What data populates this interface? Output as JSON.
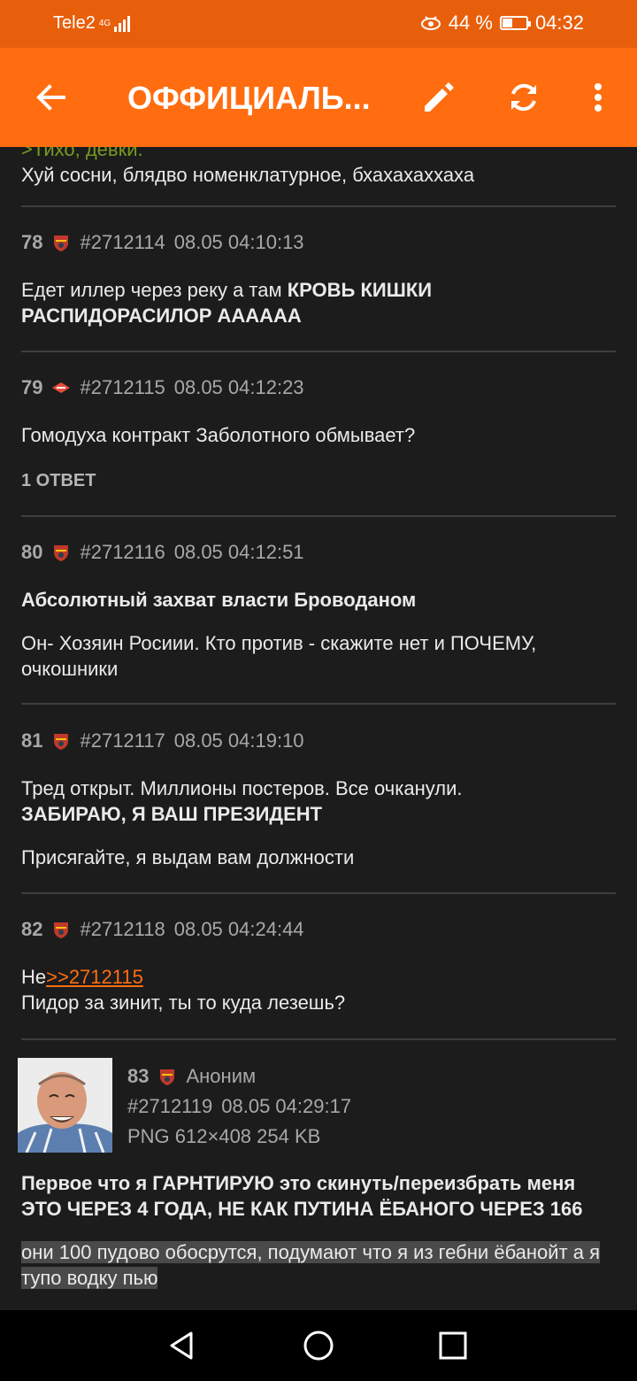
{
  "status": {
    "carrier": "Tele2",
    "network": "4G",
    "battery_pct_text": "44 %",
    "battery_level": 0.44,
    "time": "04:32"
  },
  "toolbar": {
    "title": "ОФФИЦИАЛЬ...",
    "icons": [
      "back-arrow-icon",
      "pencil-icon",
      "refresh-icon",
      "more-vert-icon"
    ]
  },
  "partial": {
    "greentext": ">Тихо, девки.",
    "text": "Хуй сосни, блядво номенклатурное, бхахахаххаха"
  },
  "posts": [
    {
      "num": "78",
      "id": "#2712114",
      "date": "08.05 04:10:13",
      "text_plain": "Едет иллер через реку а там ",
      "text_bold": "КРОВЬ КИШКИ РАСПИДОРАСИЛОР АААААА"
    },
    {
      "num": "79",
      "id": "#2712115",
      "date": "08.05 04:12:23",
      "text": "Гомодуха контракт Заболотного обмывает?",
      "replies": "1 ОТВЕТ"
    },
    {
      "num": "80",
      "id": "#2712116",
      "date": "08.05 04:12:51",
      "bold": "Абсолютный захват власти Броводаном",
      "text": "Он- Хозяин Росиии. Кто против - скажите нет и ПОЧЕМУ, очкошники"
    },
    {
      "num": "81",
      "id": "#2712117",
      "date": "08.05 04:19:10",
      "text_plain": "Тред открыт. Миллионы постеров. Все очканули.",
      "text_bold": "ЗАБИРАЮ, Я ВАШ ПРЕЗИДЕНТ",
      "text2": "Присягайте, я выдам вам должности"
    },
    {
      "num": "82",
      "id": "#2712118",
      "date": "08.05 04:24:44",
      "prefix": "Не",
      "link": ">>2712115",
      "text": "Пидор за зинит, ты то куда лезешь?"
    },
    {
      "num": "83",
      "name": "Аноним",
      "id": "#2712119",
      "date": "08.05 04:29:17",
      "file": "PNG 612×408 254 KB",
      "bold": "Первое что я ГАРНТИРУЮ это скинуть/переизбрать меня ЭТО ЧЕРЕЗ 4 ГОДА, НЕ КАК ПУТИНА ЁБАНОГО ЧЕРЕЗ 166",
      "highlight": "они 100 пудово обосрутся, подумают что я из гебни ёбанойт а я тупо водку пью"
    }
  ],
  "colors": {
    "toolbar": "#ff6d10",
    "statusbar": "#e85f0b",
    "background": "#1c1c1c",
    "link": "#ff6d10",
    "greentext": "#789922"
  }
}
